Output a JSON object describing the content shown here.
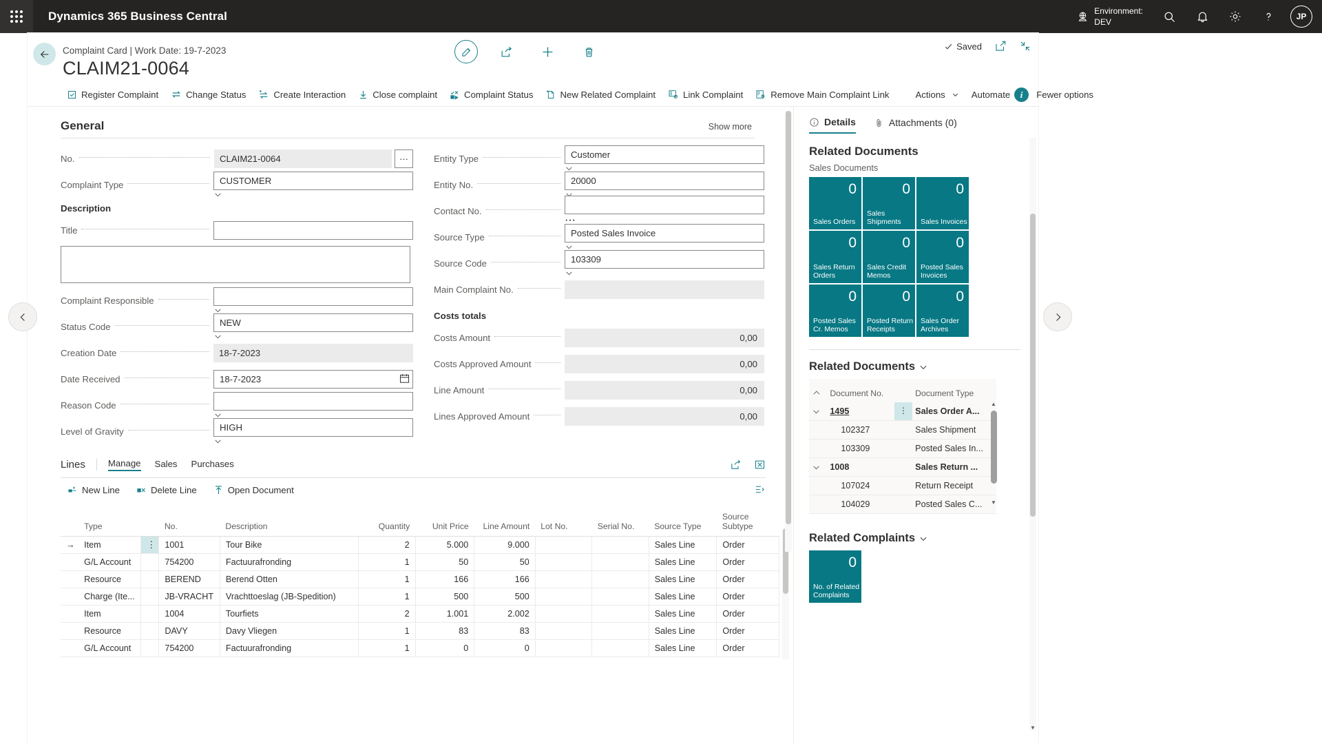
{
  "topbar": {
    "app_title": "Dynamics 365 Business Central",
    "environment_label": "Environment:",
    "environment_value": "DEV",
    "avatar_initials": "JP",
    "icons": [
      "search-icon",
      "notification-bell-icon",
      "settings-gear-icon",
      "help-question-icon"
    ]
  },
  "page": {
    "breadcrumb": "Complaint Card | Work Date: 19-7-2023",
    "title": "CLAIM21-0064",
    "saved_label": "Saved",
    "head_actions": [
      "edit-pencil-icon",
      "share-icon",
      "new-plus-icon",
      "delete-trash-icon"
    ],
    "head_right_icons": [
      "open-in-new-window-icon",
      "collapse-full-screen-icon"
    ]
  },
  "ribbon": {
    "items": [
      {
        "label": "Register Complaint",
        "icon": "register-check-icon"
      },
      {
        "label": "Change Status",
        "icon": "swap-arrows-icon"
      },
      {
        "label": "Create Interaction",
        "icon": "create-interaction-icon"
      },
      {
        "label": "Close complaint",
        "icon": "close-download-icon"
      },
      {
        "label": "Complaint Status",
        "icon": "complaint-status-icon"
      },
      {
        "label": "New Related Complaint",
        "icon": "new-document-icon"
      },
      {
        "label": "Link Complaint",
        "icon": "link-complaint-icon"
      },
      {
        "label": "Remove Main Complaint Link",
        "icon": "remove-link-icon"
      }
    ],
    "menus": [
      {
        "label": "Actions"
      },
      {
        "label": "Automate"
      }
    ],
    "fewer_options": "Fewer options",
    "info_icon": "information-icon"
  },
  "general": {
    "heading": "General",
    "show_more": "Show more",
    "left_fields": [
      {
        "label": "No.",
        "value": "CLAIM21-0064",
        "style": "readonly",
        "assist": true
      },
      {
        "label": "Complaint Type",
        "value": "CUSTOMER",
        "style": "dropdown"
      }
    ],
    "description_heading": "Description",
    "title_field": {
      "label": "Title",
      "value": "",
      "style": "input"
    },
    "description_box_value": "",
    "left_fields2": [
      {
        "label": "Complaint Responsible",
        "value": "",
        "style": "dropdown"
      },
      {
        "label": "Status Code",
        "value": "NEW",
        "style": "dropdown"
      },
      {
        "label": "Creation Date",
        "value": "18-7-2023",
        "style": "readonly"
      },
      {
        "label": "Date Received",
        "value": "18-7-2023",
        "style": "date"
      },
      {
        "label": "Reason Code",
        "value": "",
        "style": "dropdown"
      },
      {
        "label": "Level of Gravity",
        "value": "HIGH",
        "style": "dropdown"
      }
    ],
    "right_fields": [
      {
        "label": "Entity Type",
        "value": "Customer",
        "style": "dropdown"
      },
      {
        "label": "Entity No.",
        "value": "20000",
        "style": "dropdown"
      },
      {
        "label": "Contact No.",
        "value": "",
        "style": "lookup"
      },
      {
        "label": "Source Type",
        "value": "Posted Sales Invoice",
        "style": "dropdown"
      },
      {
        "label": "Source Code",
        "value": "103309",
        "style": "dropdown"
      },
      {
        "label": "Main Complaint No.",
        "value": "",
        "style": "readonly"
      }
    ],
    "costs_heading": "Costs totals",
    "costs_fields": [
      {
        "label": "Costs Amount",
        "value": "0,00",
        "style": "readonly-num"
      },
      {
        "label": "Costs Approved Amount",
        "value": "0,00",
        "style": "readonly-num"
      },
      {
        "label": "Line Amount",
        "value": "0,00",
        "style": "readonly-num"
      },
      {
        "label": "Lines Approved Amount",
        "value": "0,00",
        "style": "readonly-num"
      }
    ]
  },
  "lines": {
    "heading": "Lines",
    "tabs": [
      {
        "label": "Manage",
        "active": true
      },
      {
        "label": "Sales",
        "active": false
      },
      {
        "label": "Purchases",
        "active": false
      }
    ],
    "header_icons": [
      "share-icon",
      "open-in-excel-icon"
    ],
    "actions": [
      {
        "label": "New Line",
        "icon": "new-line-icon"
      },
      {
        "label": "Delete Line",
        "icon": "delete-line-icon"
      },
      {
        "label": "Open Document",
        "icon": "open-document-icon"
      }
    ],
    "action_right_icon": "expand-rows-icon",
    "columns": [
      "",
      "Type",
      "",
      "No.",
      "Description",
      "Quantity",
      "Unit Price",
      "Line Amount",
      "Lot No.",
      "Serial No.",
      "Source Type",
      "Source Subtype"
    ],
    "rows": [
      {
        "selected": true,
        "type": "Item",
        "no": "1001",
        "description": "Tour Bike",
        "quantity": "2",
        "unit_price": "5.000",
        "line_amount": "9.000",
        "lot_no": "",
        "serial_no": "",
        "source_type": "Sales Line",
        "source_subtype": "Order"
      },
      {
        "selected": false,
        "type": "G/L Account",
        "no": "754200",
        "description": "Factuurafronding",
        "quantity": "1",
        "unit_price": "50",
        "line_amount": "50",
        "lot_no": "",
        "serial_no": "",
        "source_type": "Sales Line",
        "source_subtype": "Order"
      },
      {
        "selected": false,
        "type": "Resource",
        "no": "BEREND",
        "description": "Berend Otten",
        "quantity": "1",
        "unit_price": "166",
        "line_amount": "166",
        "lot_no": "",
        "serial_no": "",
        "source_type": "Sales Line",
        "source_subtype": "Order"
      },
      {
        "selected": false,
        "type": "Charge (Ite...",
        "no": "JB-VRACHT",
        "description": "Vrachttoeslag (JB-Spedition)",
        "quantity": "1",
        "unit_price": "500",
        "line_amount": "500",
        "lot_no": "",
        "serial_no": "",
        "source_type": "Sales Line",
        "source_subtype": "Order"
      },
      {
        "selected": false,
        "type": "Item",
        "no": "1004",
        "description": "Tourfiets",
        "quantity": "2",
        "unit_price": "1.001",
        "line_amount": "2.002",
        "lot_no": "",
        "serial_no": "",
        "source_type": "Sales Line",
        "source_subtype": "Order"
      },
      {
        "selected": false,
        "type": "Resource",
        "no": "DAVY",
        "description": "Davy Vliegen",
        "quantity": "1",
        "unit_price": "83",
        "line_amount": "83",
        "lot_no": "",
        "serial_no": "",
        "source_type": "Sales Line",
        "source_subtype": "Order"
      },
      {
        "selected": false,
        "type": "G/L Account",
        "no": "754200",
        "description": "Factuurafronding",
        "quantity": "1",
        "unit_price": "0",
        "line_amount": "0",
        "lot_no": "",
        "serial_no": "",
        "source_type": "Sales Line",
        "source_subtype": "Order"
      }
    ]
  },
  "factbox": {
    "tabs": [
      {
        "label": "Details",
        "icon": "info-circle-icon",
        "active": true
      },
      {
        "label": "Attachments (0)",
        "icon": "paperclip-icon",
        "active": false
      }
    ],
    "related_documents_heading": "Related Documents",
    "sales_documents_label": "Sales Documents",
    "tiles": [
      {
        "value": "0",
        "label": "Sales Orders"
      },
      {
        "value": "0",
        "label": "Sales Shipments"
      },
      {
        "value": "0",
        "label": "Sales Invoices"
      },
      {
        "value": "0",
        "label": "Sales Return Orders"
      },
      {
        "value": "0",
        "label": "Sales Credit Memos"
      },
      {
        "value": "0",
        "label": "Posted Sales Invoices"
      },
      {
        "value": "0",
        "label": "Posted Sales Cr. Memos"
      },
      {
        "value": "0",
        "label": "Posted Return Receipts"
      },
      {
        "value": "0",
        "label": "Sales Order Archives"
      }
    ],
    "related_docs_section": "Related Documents",
    "rd_columns": [
      "",
      "Document No.",
      "",
      "Document Type"
    ],
    "rd_rows": [
      {
        "expand": true,
        "doc_no": "1495",
        "doc_type": "Sales Order A...",
        "bold": true,
        "selected": true,
        "indent": false,
        "link": true
      },
      {
        "expand": false,
        "doc_no": "102327",
        "doc_type": "Sales Shipment",
        "bold": false,
        "selected": false,
        "indent": true,
        "link": false
      },
      {
        "expand": false,
        "doc_no": "103309",
        "doc_type": "Posted Sales In...",
        "bold": false,
        "selected": false,
        "indent": true,
        "link": false
      },
      {
        "expand": true,
        "doc_no": "1008",
        "doc_type": "Sales Return ...",
        "bold": true,
        "selected": false,
        "indent": false,
        "link": false
      },
      {
        "expand": false,
        "doc_no": "107024",
        "doc_type": "Return Receipt",
        "bold": false,
        "selected": false,
        "indent": true,
        "link": false
      },
      {
        "expand": false,
        "doc_no": "104029",
        "doc_type": "Posted Sales C...",
        "bold": false,
        "selected": false,
        "indent": true,
        "link": false
      }
    ],
    "related_complaints_section": "Related Complaints",
    "complaints_tile": {
      "value": "0",
      "label": "No. of Related Complaints"
    }
  },
  "nav": {
    "prev_icon": "chevron-left-icon",
    "next_icon": "chevron-right-icon"
  },
  "colors": {
    "accent": "#17808a",
    "tile": "#077884",
    "selection": "#cfe7e8",
    "topbar": "#252423"
  }
}
